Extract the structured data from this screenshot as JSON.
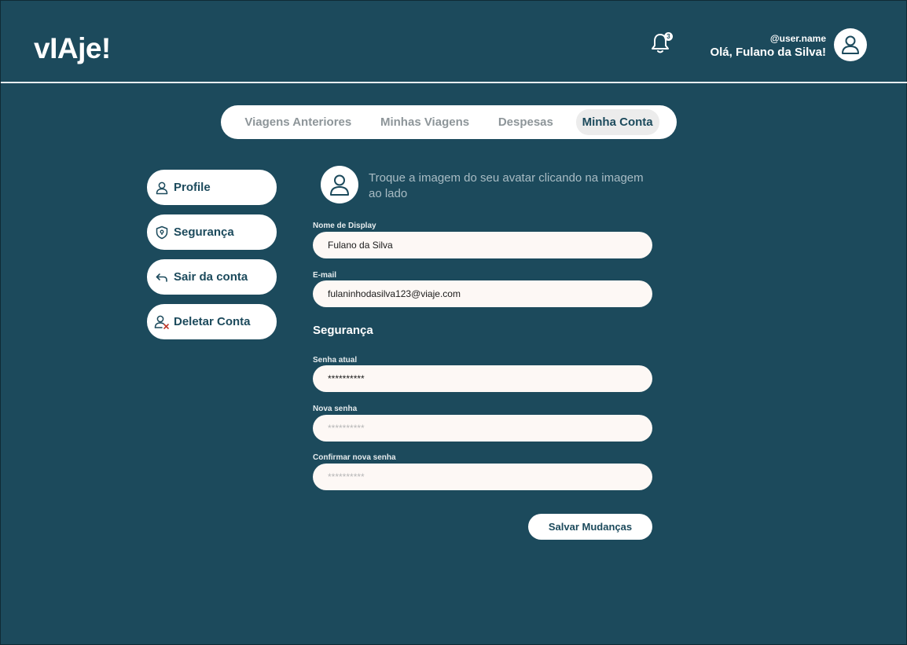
{
  "header": {
    "logo": "vIAje!",
    "notification_count": "3",
    "user_handle": "@user.name",
    "greeting": "Olá, Fulano da Silva!"
  },
  "tabs": [
    {
      "label": "Viagens Anteriores",
      "active": false
    },
    {
      "label": "Minhas Viagens",
      "active": false
    },
    {
      "label": "Despesas",
      "active": false
    },
    {
      "label": "Minha Conta",
      "active": true
    }
  ],
  "sidebar": {
    "items": [
      {
        "label": "Profile",
        "icon": "user-icon"
      },
      {
        "label": "Segurança",
        "icon": "shield-icon"
      },
      {
        "label": "Sair da conta",
        "icon": "logout-arrow-icon"
      },
      {
        "label": "Deletar Conta",
        "icon": "delete-user-icon"
      }
    ]
  },
  "profile": {
    "avatar_hint": "Troque a imagem do seu avatar clicando na imagem ao lado",
    "display_name_label": "Nome de Display",
    "display_name_value": "Fulano da Silva",
    "email_label": "E-mail",
    "email_value": "fulaninhodasilva123@viaje.com"
  },
  "security": {
    "title": "Segurança",
    "current_password_label": "Senha atual",
    "current_password_value": "**********",
    "new_password_label": "Nova senha",
    "new_password_placeholder": "**********",
    "confirm_password_label": "Confirmar nova senha",
    "confirm_password_placeholder": "**********"
  },
  "actions": {
    "save_label": "Salvar Mudanças"
  },
  "colors": {
    "background": "#1c4a5c",
    "surface": "#ffffff",
    "field": "#fdf8f5",
    "accent_text": "#1c4a5c",
    "delete_mark": "#c0392b"
  }
}
